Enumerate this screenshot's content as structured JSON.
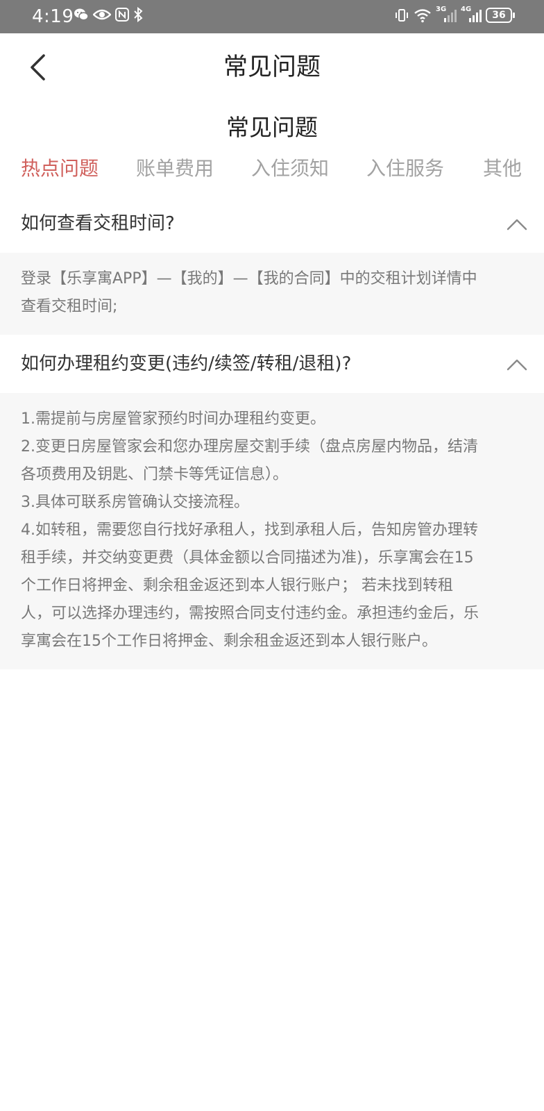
{
  "status_bar": {
    "time": "4:19",
    "left_icons": [
      "wechat-icon",
      "eye-icon",
      "nfc-icon",
      "bluetooth-icon"
    ],
    "right_icons": [
      "vibrate-icon",
      "wifi-icon",
      "signal-3g-icon",
      "signal-4g-icon"
    ],
    "network_3g": "3G",
    "network_4g": "4G",
    "battery_level": "36"
  },
  "header": {
    "title": "常见问题"
  },
  "section": {
    "title": "常见问题"
  },
  "tabs": [
    {
      "label": "热点问题",
      "active": true
    },
    {
      "label": "账单费用",
      "active": false
    },
    {
      "label": "入住须知",
      "active": false
    },
    {
      "label": "入住服务",
      "active": false
    },
    {
      "label": "其他",
      "active": false
    }
  ],
  "faqs": [
    {
      "question": "如何查看交租时间?",
      "expanded": true,
      "answer_lines": [
        "登录【乐享寓APP】—【我的】—【我的合同】中的交租计划详情中",
        "查看交租时间;"
      ]
    },
    {
      "question": "如何办理租约变更(违约/续签/转租/退租)?",
      "expanded": true,
      "answer_lines": [
        "1.需提前与房屋管家预约时间办理租约变更。",
        "2.变更日房屋管家会和您办理房屋交割手续（盘点房屋内物品，结清",
        "各项费用及钥匙、门禁卡等凭证信息）。",
        "3.具体可联系房管确认交接流程。",
        "4.如转租，需要您自行找好承租人，找到承租人后，告知房管办理转",
        "租手续，并交纳变更费（具体金额以合同描述为准)，乐享寓会在15",
        "个工作日将押金、剩余租金返还到本人银行账户；  若未找到转租",
        "人，可以选择办理违约，需按照合同支付违约金。承担违约金后，乐",
        "享寓会在15个工作日将押金、剩余租金返还到本人银行账户。"
      ]
    }
  ],
  "colors": {
    "status_bar_bg": "#7b7b7b",
    "active_tab": "#d0605c",
    "inactive_tab": "#a2a2a2",
    "answer_bg": "#f7f7f7"
  }
}
